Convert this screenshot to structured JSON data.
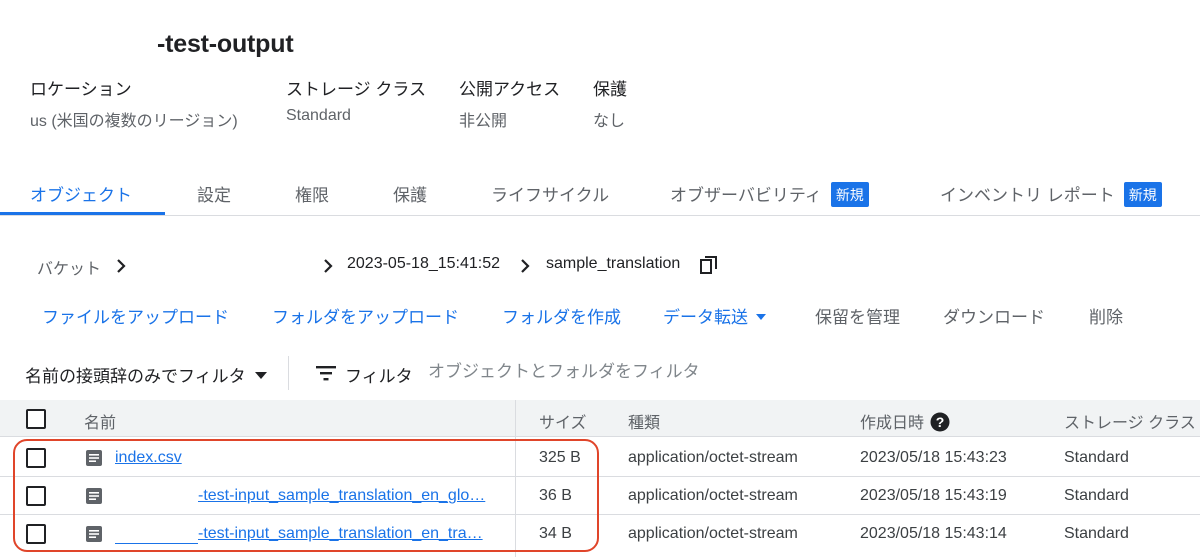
{
  "bucket": {
    "title": "-test-output"
  },
  "meta": {
    "location_label": "ロケーション",
    "location_value": "us (米国の複数のリージョン)",
    "storage_class_label": "ストレージ クラス",
    "storage_class_value": "Standard",
    "public_access_label": "公開アクセス",
    "public_access_value": "非公開",
    "protection_label": "保護",
    "protection_value": "なし"
  },
  "tabs": [
    {
      "label": "オブジェクト",
      "active": true
    },
    {
      "label": "設定"
    },
    {
      "label": "権限"
    },
    {
      "label": "保護"
    },
    {
      "label": "ライフサイクル"
    },
    {
      "label": "オブザーバビリティ",
      "badge": "新規"
    },
    {
      "label": "インベントリ レポート",
      "badge": "新規"
    }
  ],
  "breadcrumb": {
    "root": "バケット",
    "folder1": "2023-05-18_15:41:52",
    "folder2": "sample_translation"
  },
  "actions": {
    "upload_files": "ファイルをアップロード",
    "upload_folder": "フォルダをアップロード",
    "create_folder": "フォルダを作成",
    "transfer_data": "データ転送",
    "manage_holds": "保留を管理",
    "download": "ダウンロード",
    "delete": "削除"
  },
  "filter": {
    "prefix_mode": "名前の接頭辞のみでフィルタ",
    "label": "フィルタ",
    "placeholder": "オブジェクトとフォルダをフィルタ"
  },
  "table": {
    "headers": {
      "name": "名前",
      "size": "サイズ",
      "type": "種類",
      "created": "作成日時",
      "storage_class": "ストレージ クラス"
    },
    "rows": [
      {
        "name": "index.csv",
        "size": "325 B",
        "type": "application/octet-stream",
        "created": "2023/05/18 15:43:23",
        "storage_class": "Standard"
      },
      {
        "name": "-test-input_sample_translation_en_glo…",
        "size": "36 B",
        "type": "application/octet-stream",
        "created": "2023/05/18 15:43:19",
        "storage_class": "Standard"
      },
      {
        "name": "-test-input_sample_translation_en_tra…",
        "size": "34 B",
        "type": "application/octet-stream",
        "created": "2023/05/18 15:43:14",
        "storage_class": "Standard"
      }
    ]
  },
  "colors": {
    "accent": "#1a73e8",
    "highlight": "#e0452a"
  }
}
